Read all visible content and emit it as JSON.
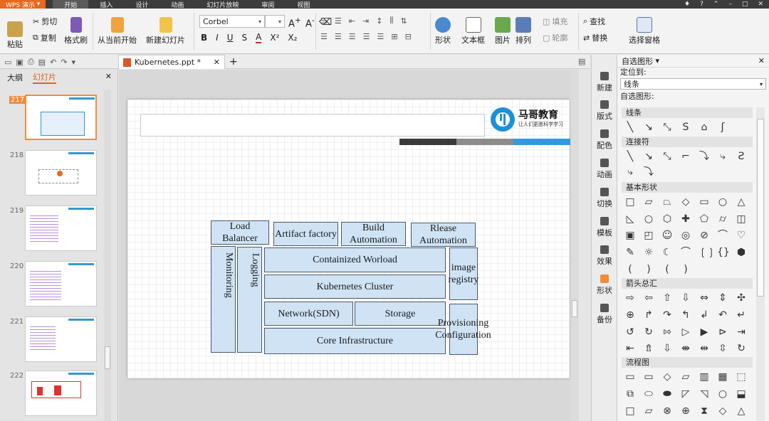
{
  "app": {
    "name": "WPS 演示",
    "menu_tabs": [
      "开始",
      "插入",
      "设计",
      "动画",
      "幻灯片放映",
      "审阅",
      "视图"
    ],
    "accent": "#e8681e"
  },
  "ribbon": {
    "paste": "粘贴",
    "cut": "剪切",
    "copy": "复制",
    "format_painter": "格式刷",
    "from_current": "从当前开始",
    "new_slide": "新建幻灯片",
    "font_name": "Corbel",
    "font_size": "",
    "shape": "形状",
    "textbox": "文本框",
    "picture": "图片",
    "arrange": "排列",
    "fill": "填充",
    "outline": "轮廓",
    "find": "查找",
    "replace": "替换",
    "select_pane": "选择窗格"
  },
  "doc": {
    "tab_title": "Kubernetes.ppt *"
  },
  "left_panel": {
    "tab_outline": "大纲",
    "tab_slides": "幻灯片",
    "slides": [
      {
        "num": "217",
        "selected": true
      },
      {
        "num": "218",
        "selected": false
      },
      {
        "num": "219",
        "selected": false
      },
      {
        "num": "220",
        "selected": false
      },
      {
        "num": "221",
        "selected": false
      },
      {
        "num": "222",
        "selected": false
      }
    ]
  },
  "slide": {
    "logo_text": "马哥教育",
    "logo_sub": "让人们更愿科学学习",
    "boxes": {
      "lb": "Load Balancer",
      "af": "Artifact factory",
      "ba": "Build Automation",
      "ra": "Rlease Automation",
      "mon": "Monitoring",
      "log": "Logging",
      "cw": "Containized Worload",
      "kc": "Kubernetes Cluster",
      "net": "Network(SDN)",
      "sto": "Storage",
      "ci": "Core Infrastructure",
      "ir": "image registry",
      "pc": "Provisioning Configuration"
    },
    "bar_colors": [
      "#3a3a3a",
      "#8c8c8c",
      "#3399dd"
    ]
  },
  "toolstrip": {
    "items": [
      "新建",
      "版式",
      "配色",
      "动画",
      "切换",
      "模板",
      "效果",
      "形状",
      "备份"
    ]
  },
  "shapes_panel": {
    "title": "自选图形",
    "locate_label": "定位到:",
    "locate_value": "线条",
    "shapes_label": "自选图形:",
    "categories": [
      "线条",
      "连接符",
      "基本形状",
      "箭头总汇",
      "流程图"
    ]
  }
}
